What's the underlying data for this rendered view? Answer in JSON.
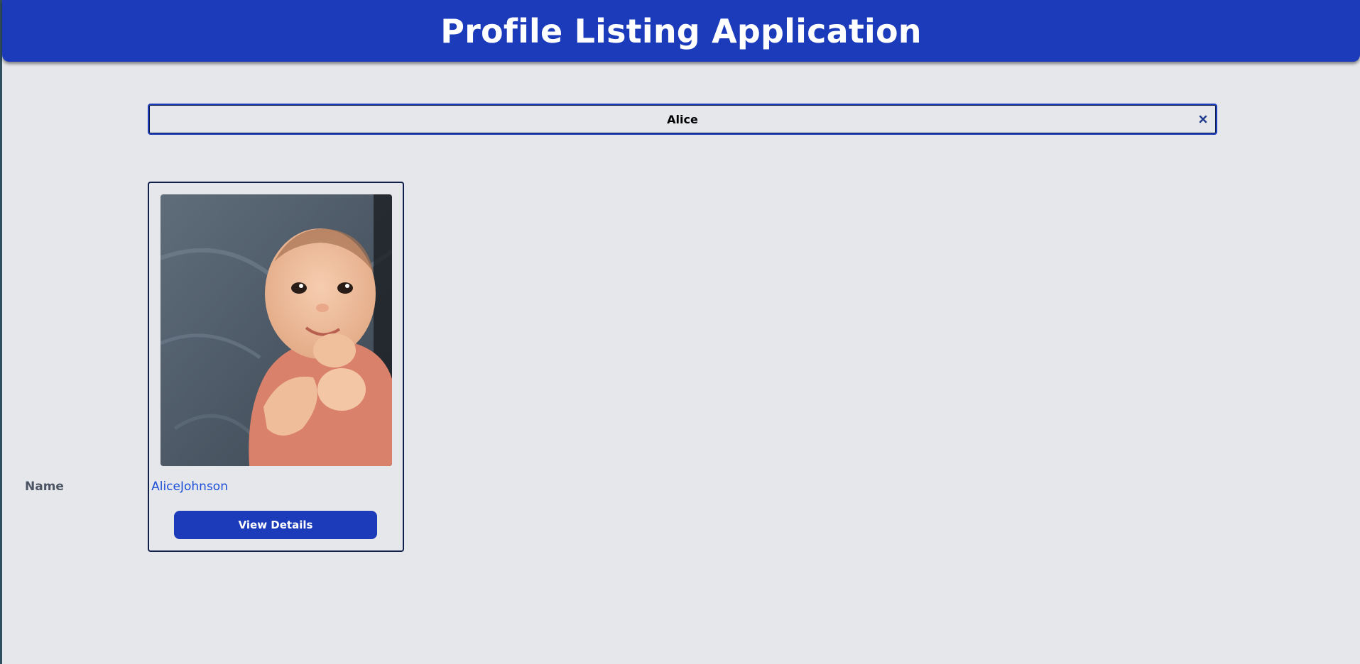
{
  "header": {
    "title": "Profile Listing Application"
  },
  "search": {
    "value": "Alice",
    "clear_icon": "close-icon"
  },
  "results": [
    {
      "photo": "baby-photo",
      "name_label": "Name",
      "name_value": "AliceJohnson",
      "button_label": "View Details"
    }
  ],
  "colors": {
    "header_bg": "#1b3bbb",
    "page_bg": "#e5e7eb",
    "accent_text": "#1d4ed8",
    "button_bg": "#1b3bbb"
  }
}
